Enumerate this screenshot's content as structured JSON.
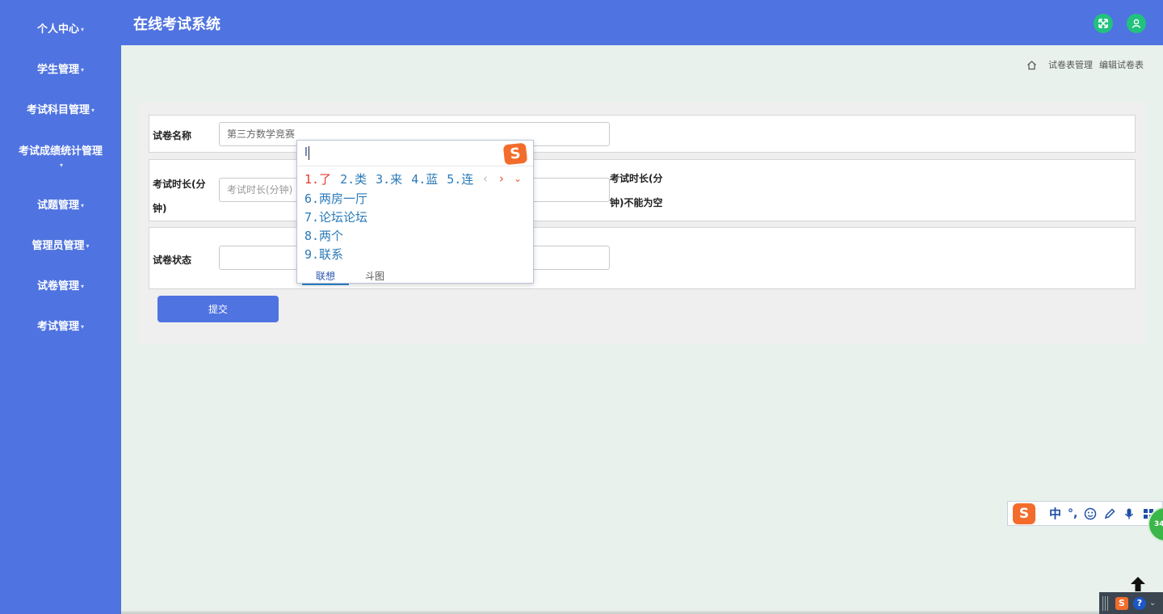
{
  "app": {
    "title": "在线考试系统"
  },
  "sidebar": {
    "items": [
      {
        "label": "个人中心"
      },
      {
        "label": "学生管理"
      },
      {
        "label": "考试科目管理"
      },
      {
        "label": "考试成绩统计管理"
      },
      {
        "label": "试题管理"
      },
      {
        "label": "管理员管理"
      },
      {
        "label": "试卷管理"
      },
      {
        "label": "考试管理"
      }
    ],
    "caret": "▾"
  },
  "breadcrumb": {
    "items": [
      "试卷表管理",
      "编辑试卷表"
    ]
  },
  "form": {
    "name": {
      "label": "试卷名称",
      "value": "第三方数学竞赛"
    },
    "duration": {
      "label_line1": "考试时长(分",
      "label_line2": "钟)",
      "placeholder": "考试时长(分钟)",
      "error_line1": "考试时长(分",
      "error_line2": "钟)不能为空"
    },
    "status": {
      "label": "试卷状态",
      "value": ""
    },
    "submit_label": "提交"
  },
  "ime": {
    "composition": "l",
    "candidates_row1": [
      "1.了",
      "2.类",
      "3.来",
      "4.蓝",
      "5.连"
    ],
    "candidates": [
      "6.两房一厅",
      "7.论坛论坛",
      "8.两个",
      "9.联系"
    ],
    "tabs": [
      "联想",
      "斗图"
    ],
    "logo": "S",
    "toolbar": {
      "mode": "中",
      "punct": "°,",
      "badge": "34"
    }
  },
  "colors": {
    "primary": "#4f73e0",
    "accent_green": "#22c27e",
    "ime_orange": "#f36c2b"
  }
}
